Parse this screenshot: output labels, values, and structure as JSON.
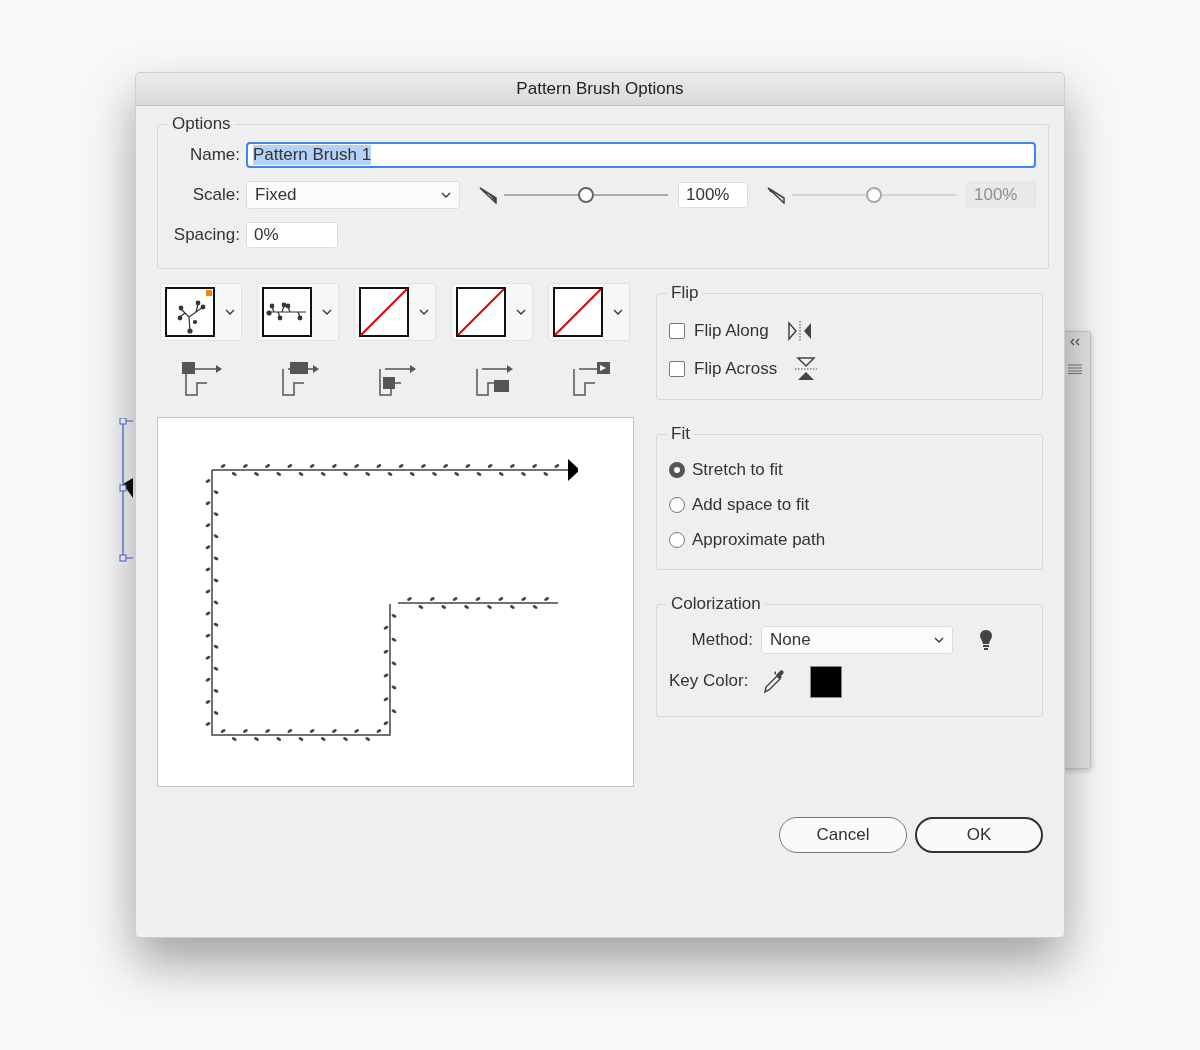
{
  "window": {
    "title": "Pattern Brush Options"
  },
  "options": {
    "legend": "Options",
    "name": {
      "label": "Name:",
      "value": "Pattern Brush 1"
    },
    "scale": {
      "label": "Scale:",
      "value": "Fixed",
      "slider": {
        "level": 0.5
      },
      "reading": "100%",
      "slider2": {
        "level": 0.5,
        "disabled": true
      },
      "reading2": "100%"
    },
    "spacing": {
      "label": "Spacing:",
      "value": "0%"
    }
  },
  "tiles": [
    {
      "kind": "branch",
      "marked": true
    },
    {
      "kind": "vine",
      "marked": false
    },
    {
      "kind": "none",
      "marked": false
    },
    {
      "kind": "none",
      "marked": false
    },
    {
      "kind": "none",
      "marked": false
    }
  ],
  "flip": {
    "legend": "Flip",
    "items": [
      {
        "label": "Flip Along",
        "checked": false,
        "kind": "along"
      },
      {
        "label": "Flip Across",
        "checked": false,
        "kind": "across"
      }
    ]
  },
  "fit": {
    "legend": "Fit",
    "items": [
      {
        "label": "Stretch to fit",
        "selected": true
      },
      {
        "label": "Add space to fit",
        "selected": false
      },
      {
        "label": "Approximate path",
        "selected": false
      }
    ]
  },
  "colorization": {
    "legend": "Colorization",
    "method": {
      "label": "Method:",
      "value": "None"
    },
    "key_color": {
      "label": "Key Color:",
      "color": "#000000"
    }
  },
  "buttons": [
    {
      "label": "Cancel",
      "kind": "cancel"
    },
    {
      "label": "OK",
      "kind": "default"
    }
  ]
}
